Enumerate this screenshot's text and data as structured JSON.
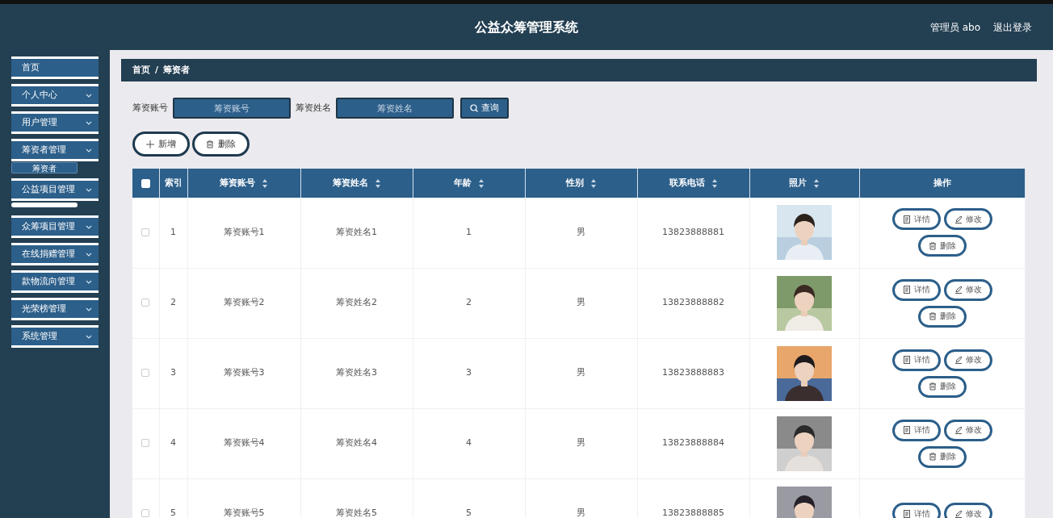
{
  "header": {
    "title": "公益众筹管理系统",
    "user": "管理员 abo",
    "logout": "退出登录"
  },
  "sidebar": {
    "items": [
      {
        "label": "首页",
        "kind": "link"
      },
      {
        "label": "个人中心",
        "kind": "menu"
      },
      {
        "label": "用户管理",
        "kind": "menu"
      },
      {
        "label": "筹资者管理",
        "kind": "menu",
        "expanded": true,
        "children": [
          {
            "label": "筹资者",
            "selected": true
          }
        ]
      },
      {
        "label": "公益项目管理",
        "kind": "menu",
        "expanded": true
      },
      {
        "label": "众筹项目管理",
        "kind": "menu"
      },
      {
        "label": "在线捐赠管理",
        "kind": "menu"
      },
      {
        "label": "款物流向管理",
        "kind": "menu"
      },
      {
        "label": "光荣榜管理",
        "kind": "menu"
      },
      {
        "label": "系统管理",
        "kind": "menu"
      }
    ]
  },
  "breadcrumb": [
    "首页",
    "筹资者"
  ],
  "breadcrumb_separator": "/",
  "search": {
    "fields": [
      {
        "label": "筹资账号",
        "placeholder": "筹资账号"
      },
      {
        "label": "筹资姓名",
        "placeholder": "筹资姓名"
      }
    ],
    "button": "查询"
  },
  "toolbar": [
    {
      "kind": "add",
      "label": "新增"
    },
    {
      "kind": "delete",
      "label": "删除"
    }
  ],
  "table": {
    "select_all_checked": false,
    "columns": [
      {
        "label": "索引",
        "sortable": false
      },
      {
        "label": "筹资账号",
        "sortable": true
      },
      {
        "label": "筹资姓名",
        "sortable": true
      },
      {
        "label": "年龄",
        "sortable": true
      },
      {
        "label": "性别",
        "sortable": true
      },
      {
        "label": "联系电话",
        "sortable": true
      },
      {
        "label": "照片",
        "sortable": true
      },
      {
        "label": "操作",
        "sortable": false
      }
    ],
    "rows": [
      {
        "checked": false,
        "index": "1",
        "account": "筹资账号1",
        "name": "筹资姓名1",
        "age": "1",
        "gender": "男",
        "phone": "13823888881",
        "photo": {
          "kind": "picture"
        },
        "actions": [
          {
            "kind": "detail",
            "label": "详情"
          },
          {
            "kind": "edit",
            "label": "修改"
          },
          {
            "kind": "delete",
            "label": "删除"
          }
        ]
      },
      {
        "checked": false,
        "index": "2",
        "account": "筹资账号2",
        "name": "筹资姓名2",
        "age": "2",
        "gender": "男",
        "phone": "13823888882",
        "photo": {
          "kind": "picture"
        },
        "actions": [
          {
            "kind": "detail",
            "label": "详情"
          },
          {
            "kind": "edit",
            "label": "修改"
          },
          {
            "kind": "delete",
            "label": "删除"
          }
        ]
      },
      {
        "checked": false,
        "index": "3",
        "account": "筹资账号3",
        "name": "筹资姓名3",
        "age": "3",
        "gender": "男",
        "phone": "13823888883",
        "photo": {
          "kind": "picture"
        },
        "actions": [
          {
            "kind": "detail",
            "label": "详情"
          },
          {
            "kind": "edit",
            "label": "修改"
          },
          {
            "kind": "delete",
            "label": "删除"
          }
        ]
      },
      {
        "checked": false,
        "index": "4",
        "account": "筹资账号4",
        "name": "筹资姓名4",
        "age": "4",
        "gender": "男",
        "phone": "13823888884",
        "photo": {
          "kind": "picture"
        },
        "actions": [
          {
            "kind": "detail",
            "label": "详情"
          },
          {
            "kind": "edit",
            "label": "修改"
          },
          {
            "kind": "delete",
            "label": "删除"
          }
        ]
      },
      {
        "checked": false,
        "index": "5",
        "account": "筹资账号5",
        "name": "筹资姓名5",
        "age": "5",
        "gender": "男",
        "phone": "13823888885",
        "photo": {
          "kind": "picture"
        },
        "actions": [
          {
            "kind": "detail",
            "label": "详情"
          },
          {
            "kind": "edit",
            "label": "修改"
          }
        ]
      }
    ]
  }
}
